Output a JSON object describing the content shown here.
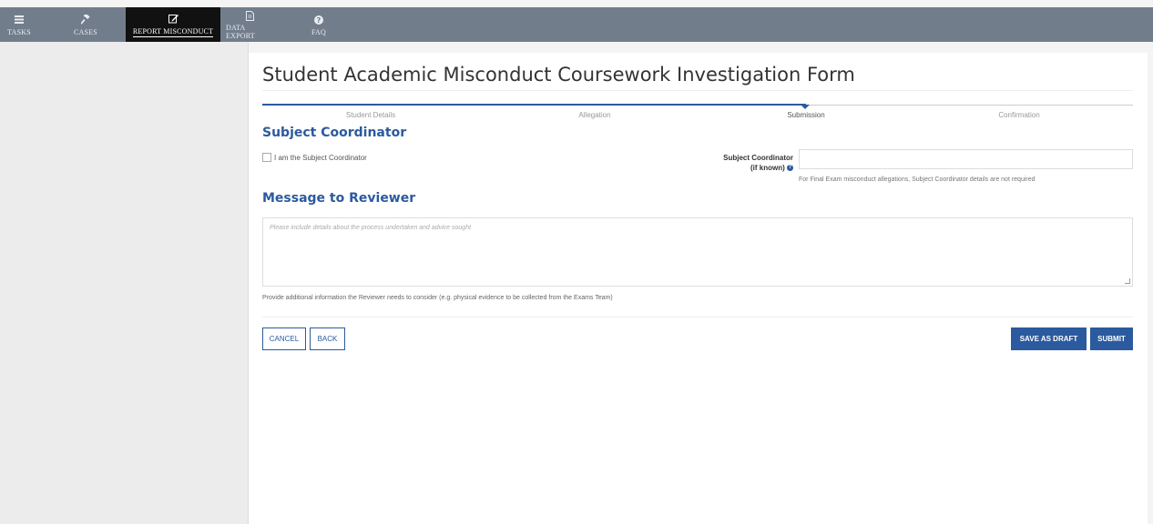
{
  "nav": {
    "items": [
      {
        "label": "TASKS",
        "icon": "list-icon"
      },
      {
        "label": "CASES",
        "icon": "gavel-icon"
      },
      {
        "label": "REPORT MISCONDUCT",
        "icon": "edit-icon"
      },
      {
        "label": "DATA EXPORT",
        "icon": "document-export-icon"
      },
      {
        "label": "FAQ",
        "icon": "question-icon"
      }
    ],
    "active": "REPORT MISCONDUCT"
  },
  "form": {
    "title": "Student Academic Misconduct Coursework Investigation Form",
    "steps": [
      "Student Details",
      "Allegation",
      "Submission",
      "Confirmation"
    ],
    "current_step": "Submission",
    "subject_coordinator": {
      "heading": "Subject Coordinator",
      "checkbox_label": "I am the Subject Coordinator",
      "field_label_line1": "Subject Coordinator",
      "field_label_line2": "(if known)",
      "help_glyph": "?",
      "field_value": "",
      "help_text": "For Final Exam misconduct allegations, Subject Coordinator details are not required"
    },
    "message": {
      "heading": "Message to Reviewer",
      "placeholder": "Please include details about the process undertaken and advice sought",
      "help_text": "Provide additional information the Reviewer needs to consider (e.g. physical evidence to be collected from the Exams Team)"
    },
    "buttons": {
      "cancel": "CANCEL",
      "back": "BACK",
      "save_draft": "SAVE AS DRAFT",
      "submit": "SUBMIT"
    }
  },
  "colors": {
    "nav_bg": "#727d8c",
    "accent": "#2b5a9e"
  }
}
